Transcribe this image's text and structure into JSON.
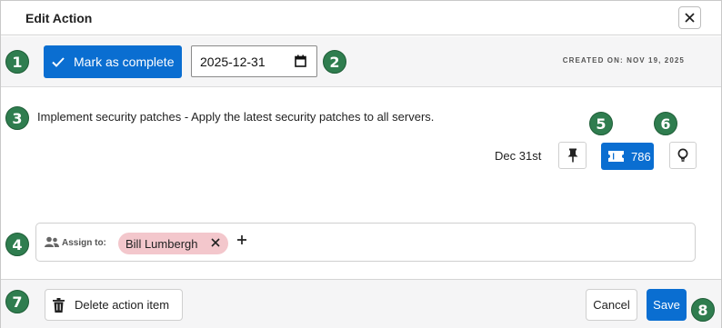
{
  "header": {
    "title": "Edit Action"
  },
  "toolbar": {
    "complete_label": "Mark as complete",
    "date_value": "2025-12-31",
    "created": "CREATED ON: NOV 19, 2025"
  },
  "item": {
    "description": "Implement security patches - Apply the latest security patches to all servers.",
    "due_label": "Dec 31st",
    "ticket_count": "786"
  },
  "assign": {
    "label": "Assign to:",
    "assignees": [
      "Bill Lumbergh"
    ]
  },
  "footer": {
    "delete_label": "Delete action item",
    "cancel_label": "Cancel",
    "save_label": "Save"
  },
  "markers": [
    "1",
    "2",
    "3",
    "4",
    "5",
    "6",
    "7",
    "8"
  ],
  "colors": {
    "primary": "#0a6ed1",
    "marker": "#2f7d4f",
    "chip": "#f3c7cc"
  }
}
